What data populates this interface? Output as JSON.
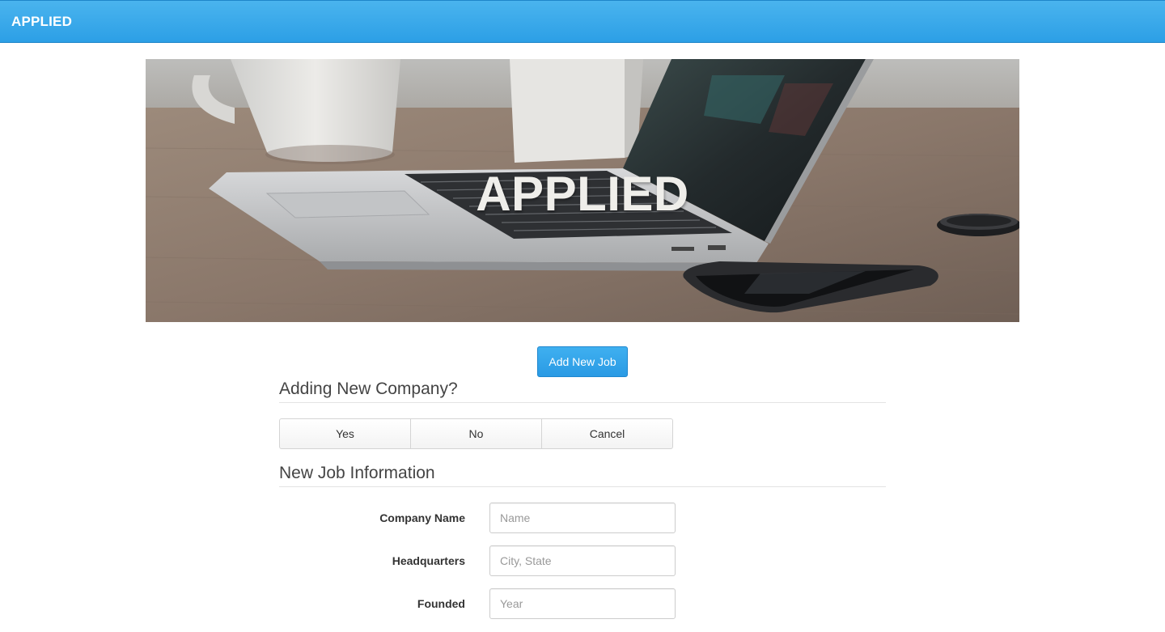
{
  "navbar": {
    "brand": "APPLIED"
  },
  "hero": {
    "title": "APPLIED"
  },
  "actions": {
    "add_job_label": "Add New Job"
  },
  "company_section": {
    "title": "Adding New Company?",
    "buttons": [
      "Yes",
      "No",
      "Cancel"
    ]
  },
  "job_section": {
    "title": "New Job Information",
    "fields": [
      {
        "label": "Company Name",
        "placeholder": "Name"
      },
      {
        "label": "Headquarters",
        "placeholder": "City, State"
      },
      {
        "label": "Founded",
        "placeholder": "Year"
      }
    ]
  },
  "colors": {
    "accent": "#2c9fe6",
    "navbar_text": "#ffffff",
    "text": "#333333"
  }
}
